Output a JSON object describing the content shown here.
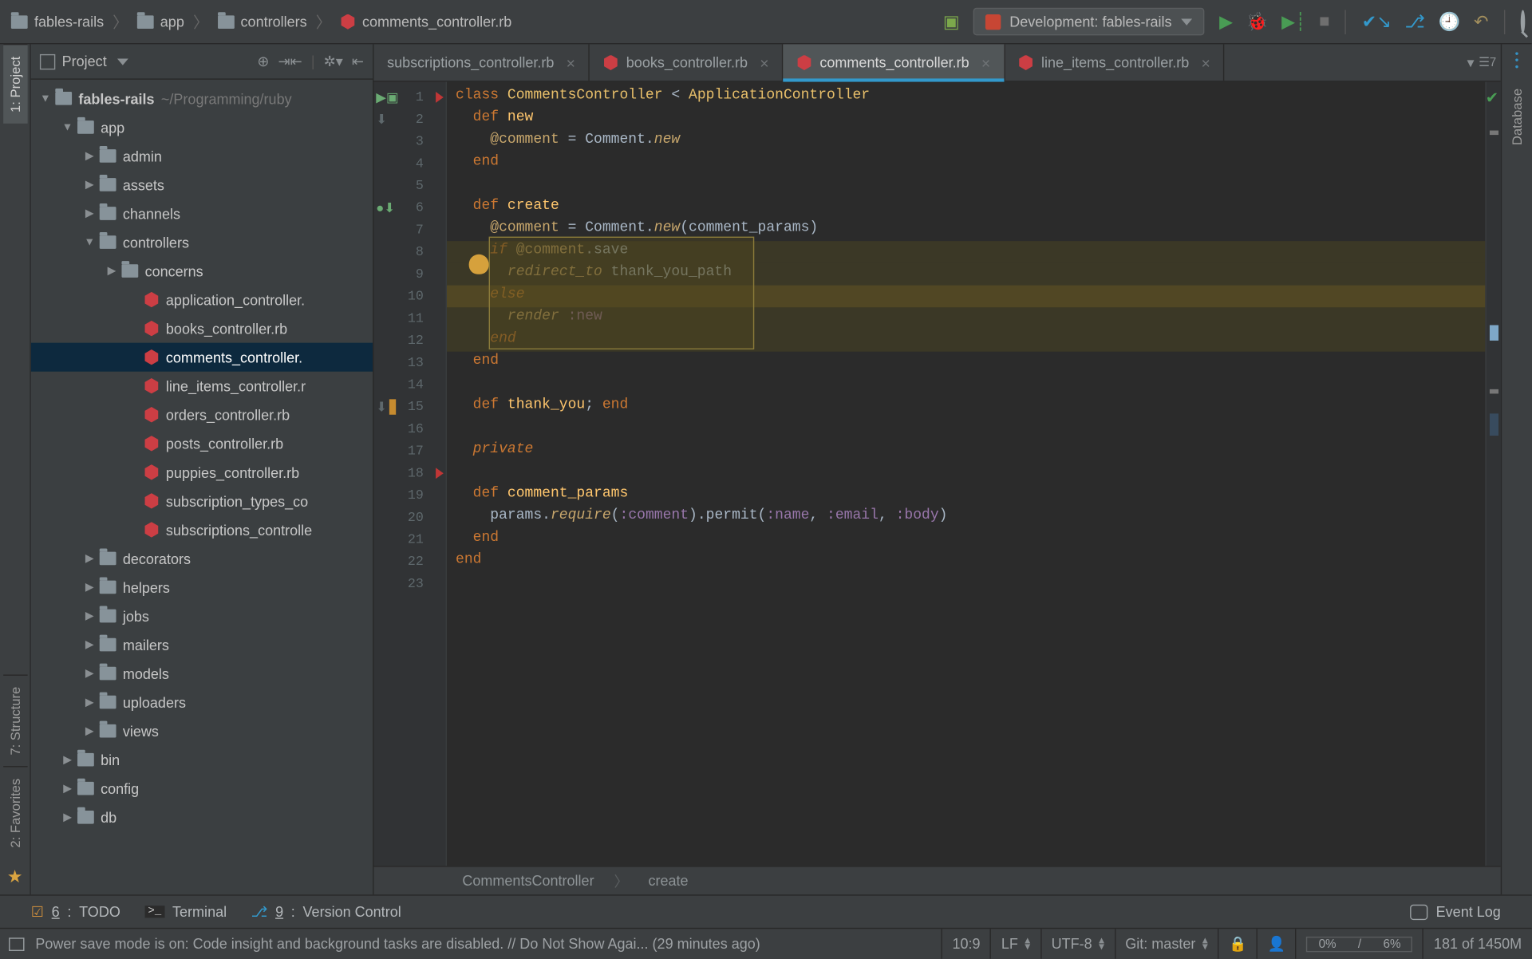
{
  "breadcrumbs": [
    "fables-rails",
    "app",
    "controllers",
    "comments_controller.rb"
  ],
  "run_config": {
    "label": "Development: fables-rails"
  },
  "left_tabs": {
    "project": "1: Project",
    "structure": "7: Structure",
    "favorites": "2: Favorites"
  },
  "right_tabs": {
    "database": "Database"
  },
  "sidebar": {
    "title": "Project",
    "tree": {
      "root": "fables-rails",
      "root_path": "~/Programming/ruby",
      "app": "app",
      "admin": "admin",
      "assets": "assets",
      "channels": "channels",
      "controllers": "controllers",
      "concerns": "concerns",
      "files": [
        "application_controller.",
        "books_controller.rb",
        "comments_controller.",
        "line_items_controller.r",
        "orders_controller.rb",
        "posts_controller.rb",
        "puppies_controller.rb",
        "subscription_types_co",
        "subscriptions_controlle"
      ],
      "decorators": "decorators",
      "helpers": "helpers",
      "jobs": "jobs",
      "mailers": "mailers",
      "models": "models",
      "uploaders": "uploaders",
      "views": "views",
      "bin": "bin",
      "config": "config",
      "db": "db"
    }
  },
  "tabs": [
    "subscriptions_controller.rb",
    "books_controller.rb",
    "comments_controller.rb",
    "line_items_controller.rb"
  ],
  "tabs_count": "7",
  "code": {
    "l1a": "class ",
    "l1b": "CommentsController",
    "l1c": " < ",
    "l1d": "ApplicationController",
    "l2a": "  def ",
    "l2b": "new",
    "l3a": "    @comment",
    "l3b": " = ",
    "l3c": "Comment",
    "l3d": ".",
    "l3e": "new",
    "l4": "  end",
    "l6a": "  def ",
    "l6b": "create",
    "l7a": "    @comment",
    "l7b": " = ",
    "l7c": "Comment",
    "l7d": ".",
    "l7e": "new",
    "l7f": "(comment_params)",
    "l8a": "    if ",
    "l8b": "@comment",
    "l8c": ".save",
    "l9a": "      redirect_to ",
    "l9b": "thank_you_path",
    "l10": "    else",
    "l11a": "      render ",
    "l11b": ":new",
    "l12": "    end",
    "l13": "  end",
    "l15a": "  def ",
    "l15b": "thank_you",
    "l15c": "; ",
    "l15d": "end",
    "l17": "  private",
    "l19a": "  def ",
    "l19b": "comment_params",
    "l20a": "    params.",
    "l20b": "require",
    "l20c": "(",
    "l20d": ":comment",
    "l20e": ").permit(",
    "l20f": ":name",
    "l20g": ", ",
    "l20h": ":email",
    "l20i": ", ",
    "l20j": ":body",
    "l20k": ")",
    "l21": "  end",
    "l22": "end"
  },
  "editor_crumbs": {
    "class": "CommentsController",
    "method": "create"
  },
  "bottom": {
    "todo_num": "6",
    "todo": "TODO",
    "terminal": "Terminal",
    "vcs_num": "9",
    "vcs": "Version Control",
    "eventlog": "Event Log"
  },
  "status": {
    "message": "Power save mode is on: Code insight and background tasks are disabled. // Do Not Show Agai... (29 minutes ago)",
    "pos": "10:9",
    "line_sep": "LF",
    "encoding": "UTF-8",
    "git": "Git: master",
    "progress_left": "0%",
    "progress_right": "6%",
    "mem": "181 of 1450M"
  }
}
